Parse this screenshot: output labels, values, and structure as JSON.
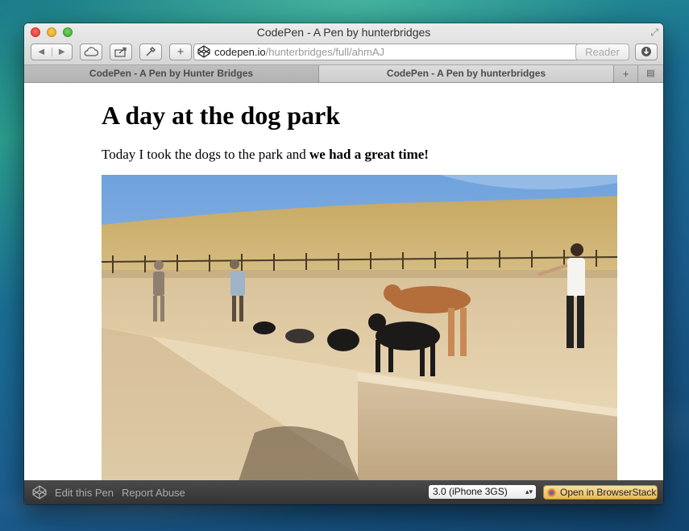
{
  "window": {
    "title": "CodePen - A Pen by hunterbridges"
  },
  "toolbar": {
    "url_host": "codepen.io",
    "url_path": "/hunterbridges/full/ahmAJ",
    "reader_label": "Reader"
  },
  "tabs": [
    {
      "label": "CodePen - A Pen by Hunter Bridges",
      "active": false
    },
    {
      "label": "CodePen - A Pen by hunterbridges",
      "active": true
    }
  ],
  "page": {
    "title": "A day at the dog park",
    "intro_text": "Today I took the dogs to the park and ",
    "intro_bold": "we had a great time!"
  },
  "bottombar": {
    "edit_label": "Edit this Pen",
    "report_label": "Report Abuse",
    "device_select": "3.0 (iPhone 3GS)",
    "browserstack_label": "Open in BrowserStack"
  },
  "icons": {
    "back": "triangle-left",
    "forward": "triangle-right",
    "cloud": "cloud",
    "share": "share-box",
    "tools": "wrench",
    "add": "plus",
    "site": "codepen-cube",
    "reload": "circular-arrow",
    "download": "down-arrow-circle"
  }
}
